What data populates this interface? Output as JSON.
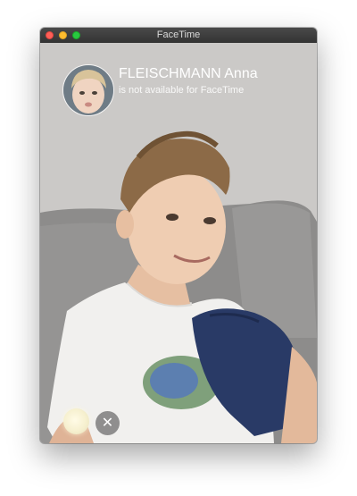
{
  "window": {
    "title": "FaceTime",
    "traffic_lights": [
      "#fe5f57",
      "#febc2e",
      "#28c840"
    ]
  },
  "caller": {
    "name": "FLEISCHMANN Anna",
    "status": "is not available for FaceTime"
  },
  "controls": {
    "close_icon": "✕"
  }
}
